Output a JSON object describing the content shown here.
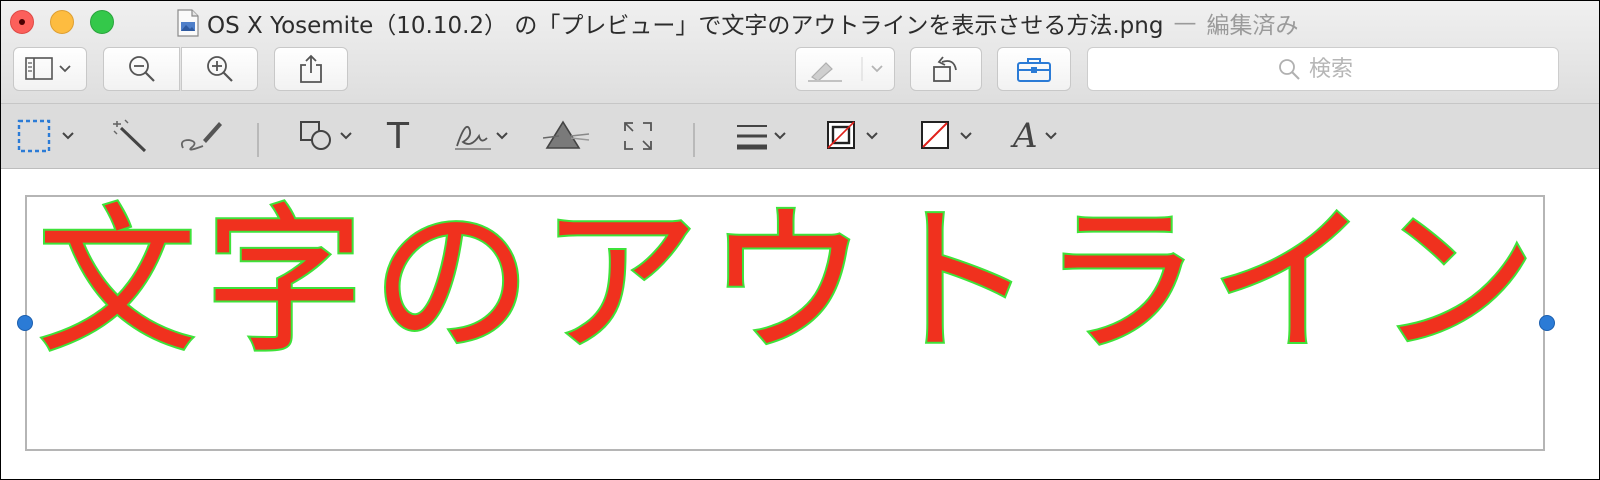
{
  "window": {
    "title": "OS X Yosemite（10.10.2） の「プレビュー」で文字のアウトラインを表示させる方法.png",
    "separator": "—",
    "status": "編集済み"
  },
  "toolbar": {
    "search_placeholder": "検索",
    "items": [
      "sidebar-toggle",
      "zoom-out",
      "zoom-in",
      "share",
      "highlight",
      "rotate",
      "markup-toolbox"
    ]
  },
  "markup_toolbar": {
    "tools": [
      "rectangular-selection",
      "instant-alpha",
      "sketch",
      "shapes",
      "text",
      "sign",
      "adjust-color",
      "adjust-size",
      "line-style",
      "border-color",
      "fill-color",
      "text-style"
    ],
    "text_tool_glyph": "T",
    "text_style_glyph": "A"
  },
  "canvas": {
    "text": "文字のアウトライン",
    "characters": [
      "文",
      "字",
      "の",
      "ア",
      "ウ",
      "ト",
      "ラ",
      "イ",
      "ン"
    ],
    "fill_color": "#f0311e",
    "outline_color": "#3ee23a"
  },
  "colors": {
    "accent": "#2b7bd6",
    "close": "#fc605b",
    "minimize": "#fdbc40",
    "zoom": "#34c84a"
  }
}
